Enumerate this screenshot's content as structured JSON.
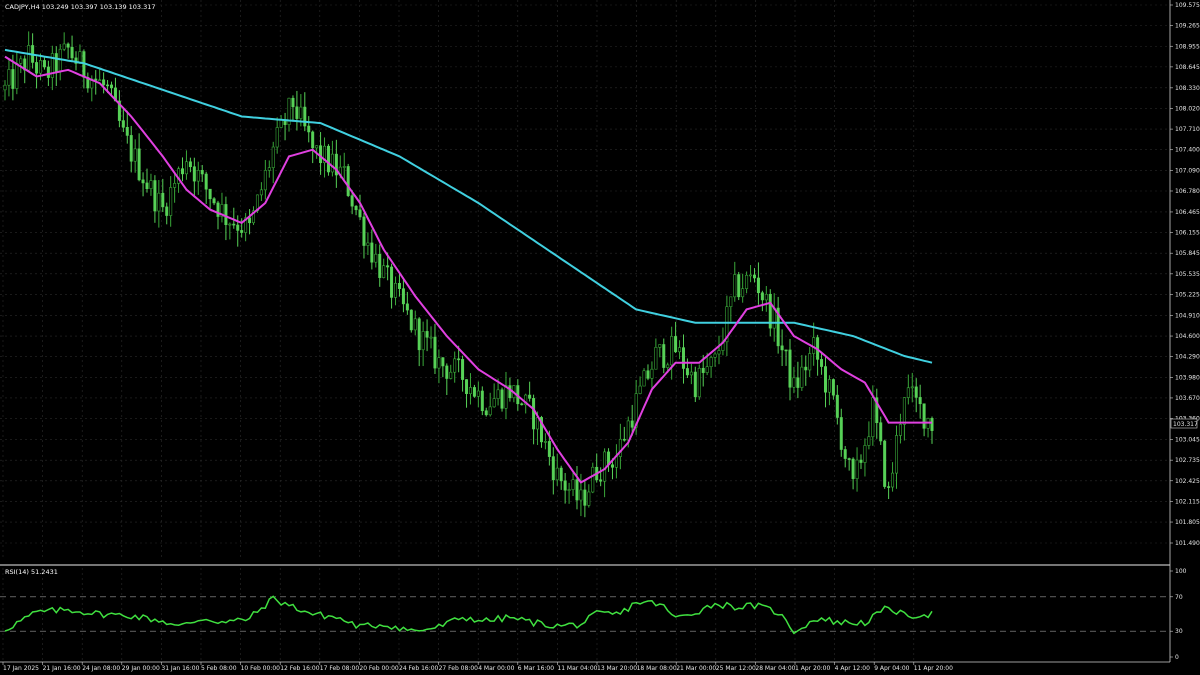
{
  "window": {
    "symbol_header": "CADJPY,H4  103.249 103.397 103.139 103.317",
    "rsi_header": "RSI(14) 51.2431",
    "current_price_tag": "103.317"
  },
  "colors": {
    "background": "#000000",
    "grid": "#2b2b2b",
    "candles": "#3fbf3f",
    "ma_fast": "#e040e0",
    "ma_slow": "#40d0e0",
    "rsi_line": "#40e040",
    "axis_text": "#e6e6e6"
  },
  "price_axis": {
    "ticks": [
      "109.575",
      "109.265",
      "108.955",
      "108.645",
      "108.330",
      "108.020",
      "107.710",
      "107.400",
      "107.090",
      "106.780",
      "106.465",
      "106.155",
      "105.845",
      "105.535",
      "105.225",
      "104.910",
      "104.600",
      "104.290",
      "103.980",
      "103.670",
      "103.360",
      "103.045",
      "102.735",
      "102.425",
      "102.115",
      "101.805",
      "101.490"
    ]
  },
  "rsi_axis": {
    "ticks": [
      "100",
      "70",
      "30",
      "0"
    ]
  },
  "time_axis": {
    "labels": [
      "17 Jan 2025",
      "21 Jan 16:00",
      "24 Jan 08:00",
      "29 Jan 00:00",
      "31 Jan 16:00",
      "5 Feb 08:00",
      "10 Feb 00:00",
      "12 Feb 16:00",
      "17 Feb 08:00",
      "20 Feb 00:00",
      "24 Feb 16:00",
      "27 Feb 08:00",
      "4 Mar 00:00",
      "6 Mar 16:00",
      "11 Mar 04:00",
      "13 Mar 20:00",
      "18 Mar 08:00",
      "21 Mar 00:00",
      "25 Mar 12:00",
      "28 Mar 04:00",
      "1 Apr 20:00",
      "4 Apr 12:00",
      "9 Apr 04:00",
      "11 Apr 20:00"
    ]
  },
  "chart_data": {
    "type": "candlestick",
    "symbol": "CADJPY",
    "timeframe": "H4",
    "y_range": [
      101.3,
      109.6
    ],
    "price_shape_keypoints": [
      [
        0,
        108.3
      ],
      [
        6,
        108.8
      ],
      [
        10,
        108.5
      ],
      [
        16,
        108.9
      ],
      [
        20,
        108.6
      ],
      [
        26,
        108.3
      ],
      [
        30,
        107.6
      ],
      [
        36,
        106.9
      ],
      [
        40,
        106.5
      ],
      [
        46,
        107.3
      ],
      [
        50,
        106.9
      ],
      [
        56,
        106.4
      ],
      [
        62,
        106.2
      ],
      [
        68,
        107.4
      ],
      [
        73,
        108.1
      ],
      [
        78,
        107.4
      ],
      [
        82,
        107.2
      ],
      [
        86,
        107.0
      ],
      [
        92,
        106.0
      ],
      [
        98,
        105.3
      ],
      [
        104,
        104.7
      ],
      [
        110,
        104.2
      ],
      [
        116,
        104.0
      ],
      [
        122,
        103.6
      ],
      [
        128,
        103.8
      ],
      [
        134,
        103.4
      ],
      [
        140,
        102.5
      ],
      [
        146,
        102.1
      ],
      [
        150,
        102.6
      ],
      [
        155,
        102.8
      ],
      [
        160,
        103.6
      ],
      [
        165,
        104.3
      ],
      [
        170,
        104.4
      ],
      [
        175,
        103.9
      ],
      [
        180,
        104.2
      ],
      [
        185,
        105.3
      ],
      [
        190,
        105.5
      ],
      [
        195,
        104.8
      ],
      [
        200,
        103.8
      ],
      [
        205,
        104.4
      ],
      [
        210,
        103.6
      ],
      [
        215,
        102.3
      ],
      [
        220,
        103.5
      ],
      [
        224,
        102.2
      ],
      [
        228,
        103.8
      ],
      [
        232,
        103.5
      ],
      [
        235,
        103.3
      ]
    ],
    "ma_fast_keypoints": [
      [
        0,
        108.8
      ],
      [
        8,
        108.5
      ],
      [
        16,
        108.6
      ],
      [
        24,
        108.4
      ],
      [
        32,
        107.9
      ],
      [
        40,
        107.3
      ],
      [
        46,
        106.8
      ],
      [
        52,
        106.5
      ],
      [
        60,
        106.3
      ],
      [
        66,
        106.6
      ],
      [
        72,
        107.3
      ],
      [
        78,
        107.4
      ],
      [
        84,
        107.1
      ],
      [
        90,
        106.6
      ],
      [
        96,
        105.9
      ],
      [
        104,
        105.2
      ],
      [
        112,
        104.6
      ],
      [
        120,
        104.1
      ],
      [
        128,
        103.8
      ],
      [
        134,
        103.5
      ],
      [
        140,
        102.9
      ],
      [
        146,
        102.4
      ],
      [
        152,
        102.6
      ],
      [
        158,
        103.0
      ],
      [
        164,
        103.8
      ],
      [
        170,
        104.2
      ],
      [
        176,
        104.2
      ],
      [
        182,
        104.5
      ],
      [
        188,
        105.0
      ],
      [
        194,
        105.1
      ],
      [
        200,
        104.6
      ],
      [
        206,
        104.4
      ],
      [
        212,
        104.1
      ],
      [
        218,
        103.9
      ],
      [
        224,
        103.3
      ],
      [
        230,
        103.3
      ],
      [
        235,
        103.3
      ]
    ],
    "ma_slow_keypoints": [
      [
        0,
        108.9
      ],
      [
        20,
        108.7
      ],
      [
        40,
        108.3
      ],
      [
        60,
        107.9
      ],
      [
        80,
        107.8
      ],
      [
        100,
        107.3
      ],
      [
        120,
        106.6
      ],
      [
        140,
        105.8
      ],
      [
        160,
        105.0
      ],
      [
        175,
        104.8
      ],
      [
        190,
        104.8
      ],
      [
        200,
        104.8
      ],
      [
        215,
        104.6
      ],
      [
        228,
        104.3
      ],
      [
        235,
        104.2
      ]
    ],
    "rsi_keypoints": [
      [
        0,
        32
      ],
      [
        8,
        52
      ],
      [
        16,
        55
      ],
      [
        24,
        50
      ],
      [
        32,
        48
      ],
      [
        40,
        42
      ],
      [
        44,
        35
      ],
      [
        50,
        45
      ],
      [
        56,
        40
      ],
      [
        62,
        45
      ],
      [
        68,
        68
      ],
      [
        72,
        60
      ],
      [
        78,
        50
      ],
      [
        84,
        46
      ],
      [
        90,
        35
      ],
      [
        96,
        38
      ],
      [
        104,
        30
      ],
      [
        110,
        35
      ],
      [
        116,
        46
      ],
      [
        122,
        42
      ],
      [
        128,
        46
      ],
      [
        134,
        40
      ],
      [
        140,
        36
      ],
      [
        146,
        38
      ],
      [
        150,
        50
      ],
      [
        156,
        50
      ],
      [
        160,
        64
      ],
      [
        166,
        62
      ],
      [
        170,
        45
      ],
      [
        176,
        54
      ],
      [
        180,
        62
      ],
      [
        186,
        58
      ],
      [
        190,
        60
      ],
      [
        196,
        52
      ],
      [
        200,
        30
      ],
      [
        206,
        45
      ],
      [
        212,
        40
      ],
      [
        218,
        40
      ],
      [
        224,
        58
      ],
      [
        228,
        48
      ],
      [
        235,
        50
      ]
    ],
    "rsi_levels": [
      70,
      30
    ]
  }
}
